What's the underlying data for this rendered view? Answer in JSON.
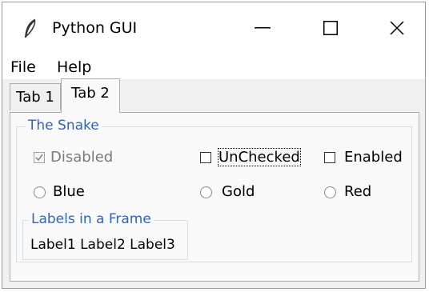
{
  "window": {
    "title": "Python GUI"
  },
  "menu": {
    "file": "File",
    "help": "Help"
  },
  "tabs": [
    {
      "label": "Tab 1"
    },
    {
      "label": "Tab 2",
      "selected": true
    }
  ],
  "snake_frame": {
    "title": "The Snake",
    "checkboxes": [
      {
        "label": "Disabled",
        "checked": true,
        "disabled": true
      },
      {
        "label": "UnChecked",
        "checked": false,
        "focused": true
      },
      {
        "label": "Enabled",
        "checked": false
      }
    ],
    "radios": [
      {
        "label": "Blue",
        "selected": false
      },
      {
        "label": "Gold",
        "selected": false
      },
      {
        "label": "Red",
        "selected": false
      }
    ]
  },
  "labels_frame": {
    "title": "Labels in a Frame",
    "text": "Label1 Label2 Label3"
  },
  "colors": {
    "frame_title": "#2e65c4",
    "window_bg": "#f0f0f0",
    "panel_bg": "#f9f9f9"
  }
}
